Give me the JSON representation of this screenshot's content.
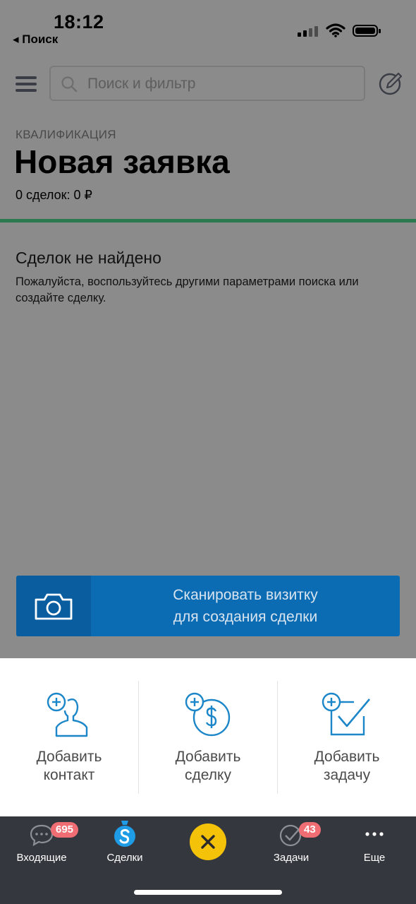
{
  "status_bar": {
    "time": "18:12",
    "back_label": "◂ Поиск"
  },
  "header": {
    "search_placeholder": "Поиск и фильтр"
  },
  "pipeline": {
    "stage": "КВАЛИФИКАЦИЯ",
    "title": "Новая заявка",
    "deals_count": "0 сделок: 0 ₽",
    "stage_color": "#2b7a4f"
  },
  "empty_state": {
    "title": "Сделок не найдено",
    "text": "Пожалуйста, воспользуйтесь другими параметрами поиска или создайте сделку."
  },
  "scan_button": {
    "line1": "Сканировать визитку",
    "line2": "для создания сделки"
  },
  "actions": [
    {
      "line1": "Добавить",
      "line2": "контакт",
      "icon": "add-contact-icon"
    },
    {
      "line1": "Добавить",
      "line2": "сделку",
      "icon": "add-deal-icon"
    },
    {
      "line1": "Добавить",
      "line2": "задачу",
      "icon": "add-task-icon"
    }
  ],
  "tab_bar": {
    "inbox": {
      "label": "Входящие",
      "badge": "695",
      "icon": "chat-icon"
    },
    "deals": {
      "label": "Сделки",
      "icon": "deals-icon"
    },
    "tasks": {
      "label": "Задачи",
      "badge": "43",
      "icon": "check-icon"
    },
    "more": {
      "label": "Еще",
      "icon": "more-icon"
    }
  },
  "colors": {
    "accent_blue": "#0c6cb3",
    "fab_yellow": "#f5c20a",
    "badge_red": "#f06d73",
    "tab_bar_bg": "#35373e"
  }
}
